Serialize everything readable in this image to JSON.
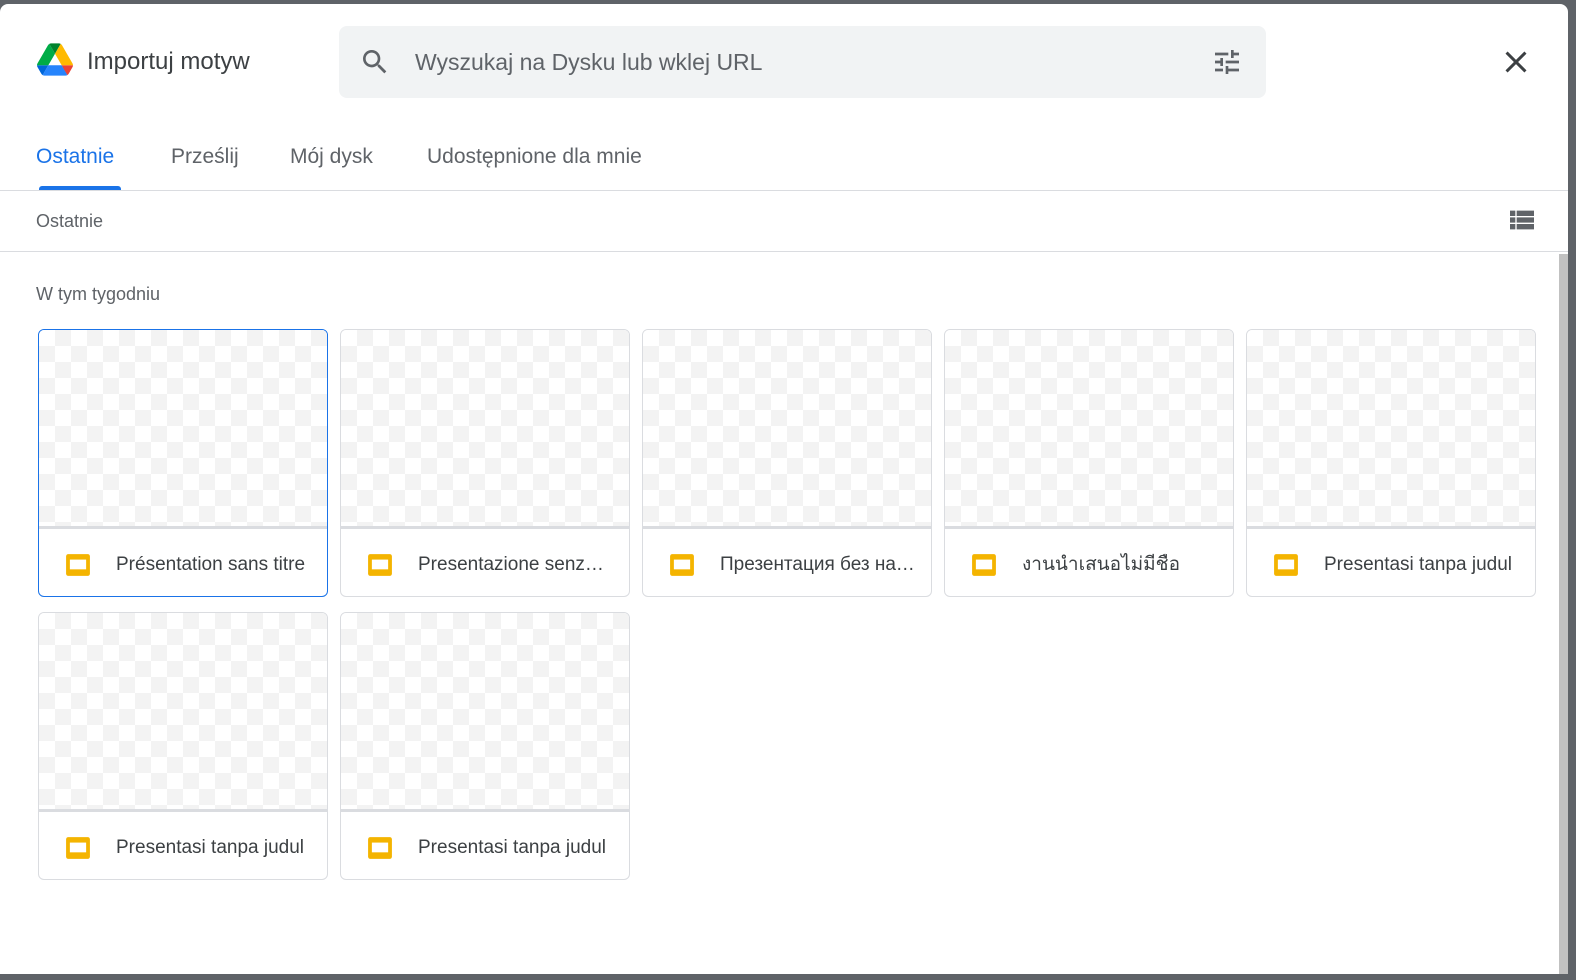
{
  "header": {
    "title": "Importuj motyw",
    "search_placeholder": "Wyszukaj na Dysku lub wklej URL"
  },
  "tabs": [
    {
      "label": "Ostatnie",
      "active": true
    },
    {
      "label": "Prześlij",
      "active": false
    },
    {
      "label": "Mój dysk",
      "active": false
    },
    {
      "label": "Udostępnione dla mnie",
      "active": false
    }
  ],
  "toolbar": {
    "breadcrumb": "Ostatnie"
  },
  "section": {
    "title": "W tym tygodniu"
  },
  "files": [
    {
      "name": "Présentation sans titre",
      "selected": true
    },
    {
      "name": "Presentazione senza titolo",
      "selected": false
    },
    {
      "name": "Презентация без названия",
      "selected": false
    },
    {
      "name": "งานนำเสนอไม่มีชื่อ",
      "selected": false
    },
    {
      "name": "Presentasi tanpa judul",
      "selected": false
    },
    {
      "name": "Presentasi tanpa judul",
      "selected": false
    },
    {
      "name": "Presentasi tanpa judul",
      "selected": false
    }
  ],
  "icons": {
    "logo": "google-drive-logo",
    "search": "search-icon",
    "tune": "tune-icon",
    "close": "close-icon",
    "list_view": "list-view-icon",
    "file": "slides-icon"
  },
  "colors": {
    "accent": "#1a73e8",
    "slides": "#f4b400",
    "text": "#3c4043",
    "secondary_text": "#5f6368"
  }
}
